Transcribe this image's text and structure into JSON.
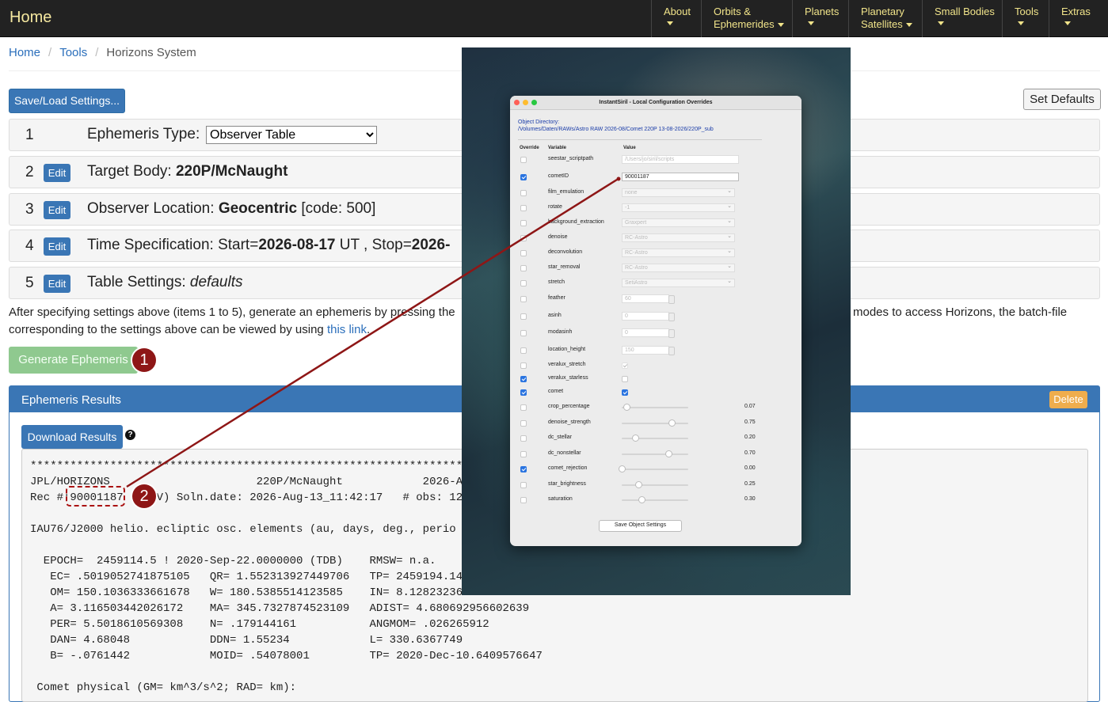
{
  "navbar": {
    "brand": "Home",
    "items": [
      {
        "line1": "About",
        "line2": ""
      },
      {
        "line1": "Orbits &",
        "line2": "Ephemerides"
      },
      {
        "line1": "Planets",
        "line2": ""
      },
      {
        "line1": "Planetary",
        "line2": "Satellites"
      },
      {
        "line1": "Small Bodies",
        "line2": ""
      },
      {
        "line1": "Tools",
        "line2": ""
      },
      {
        "line1": "Extras",
        "line2": ""
      }
    ]
  },
  "breadcrumb": {
    "home": "Home",
    "tools": "Tools",
    "current": "Horizons System"
  },
  "buttons": {
    "save_load": "Save/Load Settings...",
    "set_defaults": "Set Defaults",
    "edit": "Edit",
    "generate": "Generate Ephemeris",
    "download": "Download Results",
    "delete": "Delete",
    "help": "?"
  },
  "settings": {
    "r1": {
      "num": "1",
      "label": "Ephemeris Type:",
      "value": "Observer Table"
    },
    "r2": {
      "num": "2",
      "label": "Target Body:",
      "value": "220P/McNaught"
    },
    "r3": {
      "num": "3",
      "label": "Observer Location:",
      "value": "Geocentric",
      "suffix": "[code: 500]"
    },
    "r4": {
      "num": "4",
      "label": "Time Specification: Start=",
      "start": "2026-08-17",
      "mid": " UT , Stop=",
      "stop": "2026-"
    },
    "r5": {
      "num": "5",
      "label": "Table Settings:",
      "value": "defaults"
    }
  },
  "instructions": {
    "a": "After specifying settings above (items 1 to 5), generate an ephemeris by pressing the",
    "b": "modes to access Horizons, the batch-file",
    "c": "corresponding to the settings above can be viewed by using",
    "link": "this link",
    "d": "."
  },
  "badges": {
    "one": "1",
    "two": "2"
  },
  "results": {
    "title": "Ephemeris Results",
    "lines": [
      "*******************************************************************************",
      "JPL/HORIZONS                      220P/McNaught            2026-A",
      "Rec #:90001187 (+COV) Soln.date: 2026-Aug-13_11:42:17   # obs: 12",
      "",
      "IAU76/J2000 helio. ecliptic osc. elements (au, days, deg., perio",
      "",
      "  EPOCH=  2459114.5 ! 2020-Sep-22.0000000 (TDB)    RMSW= n.a.",
      "   EC= .5019052741875105   QR= 1.552313927449706   TP= 2459194.14",
      "   OM= 150.1036333661678   W= 180.5385514123585    IN= 8.12823236",
      "   A= 3.116503442026172    MA= 345.7327874523109   ADIST= 4.680692956602639",
      "   PER= 5.5018610569308    N= .179144161           ANGMOM= .026265912",
      "   DAN= 4.68048            DDN= 1.55234            L= 330.6367749",
      "   B= -.0761442            MOID= .54078001         TP= 2020-Dec-10.6409576647",
      "",
      " Comet physical (GM= km^3/s^2; RAD= km):"
    ]
  },
  "dialog": {
    "title": "InstantSiril - Local Configuration Overrides",
    "dir_label": "Object Directory:",
    "dir_path": "/Volumes/Daten/RAWs/Astro RAW 2026-08/Comet 220P 13-08-2026/220P_sub",
    "col_override": "Override",
    "col_variable": "Variable",
    "col_value": "Value",
    "save": "Save Object Settings",
    "rows": [
      {
        "name": "seestar_scriptpath",
        "override": false,
        "kind": "text",
        "value": "/Users/jo/siril/scripts"
      },
      {
        "name": "cometID",
        "override": true,
        "kind": "text",
        "value": "90001187"
      },
      {
        "name": "film_emulation",
        "override": false,
        "kind": "select",
        "value": "none"
      },
      {
        "name": "rotate",
        "override": false,
        "kind": "select",
        "value": "-1"
      },
      {
        "name": "background_extraction",
        "override": false,
        "kind": "select",
        "value": "Graxpert"
      },
      {
        "name": "denoise",
        "override": false,
        "kind": "select",
        "value": "RC-Astro"
      },
      {
        "name": "deconvolution",
        "override": false,
        "kind": "select",
        "value": "RC-Astro"
      },
      {
        "name": "star_removal",
        "override": false,
        "kind": "select",
        "value": "RC-Astro"
      },
      {
        "name": "stretch",
        "override": false,
        "kind": "select",
        "value": "SetiAstro"
      },
      {
        "name": "feather",
        "override": false,
        "kind": "number",
        "value": "60"
      },
      {
        "name": "asinh",
        "override": false,
        "kind": "number",
        "value": "0"
      },
      {
        "name": "modasinh",
        "override": false,
        "kind": "number",
        "value": "0"
      },
      {
        "name": "location_height",
        "override": false,
        "kind": "number",
        "value": "150"
      },
      {
        "name": "veralux_stretch",
        "override": false,
        "kind": "check",
        "checked": true
      },
      {
        "name": "veralux_starless",
        "override": true,
        "kind": "check",
        "checked": false
      },
      {
        "name": "comet",
        "override": true,
        "kind": "check",
        "checked": true
      },
      {
        "name": "crop_percentage",
        "override": false,
        "kind": "slider",
        "level": 0.07,
        "value": "0.07"
      },
      {
        "name": "denoise_strength",
        "override": false,
        "kind": "slider",
        "level": 0.75,
        "value": "0.75"
      },
      {
        "name": "dc_stellar",
        "override": false,
        "kind": "slider",
        "level": 0.2,
        "value": "0.20"
      },
      {
        "name": "dc_nonstellar",
        "override": false,
        "kind": "slider",
        "level": 0.7,
        "value": "0.70"
      },
      {
        "name": "comet_rejection",
        "override": true,
        "kind": "slider",
        "level": 0.0,
        "value": "0.00"
      },
      {
        "name": "star_brightness",
        "override": false,
        "kind": "slider",
        "level": 0.25,
        "value": "0.25"
      },
      {
        "name": "saturation",
        "override": false,
        "kind": "slider",
        "level": 0.3,
        "value": "0.30"
      }
    ]
  },
  "colors": {
    "accent": "#3a76b5",
    "navbar": "#222222",
    "nav_text": "#f1e48a",
    "marker": "#8e1616",
    "success": "#8fc98f",
    "warning": "#efad4d"
  }
}
